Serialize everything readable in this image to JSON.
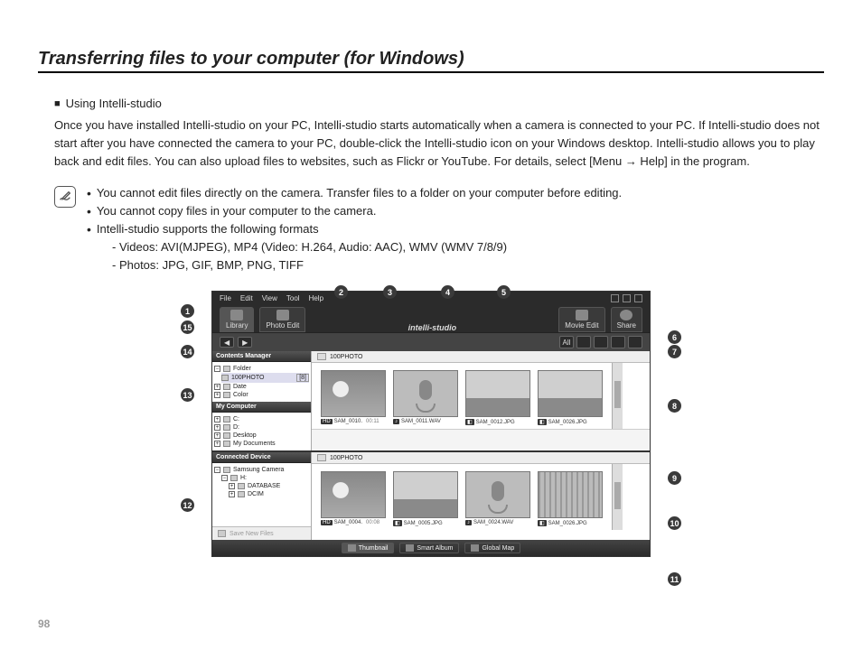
{
  "page": {
    "title": "Transferring files to your computer (for Windows)",
    "number": "98"
  },
  "section": {
    "subhead": "Using Intelli-studio",
    "paragraph": "Once you have installed Intelli-studio on your PC, Intelli-studio starts automatically when a camera is connected to your PC. If Intelli-studio does not start after you have connected the camera to your PC, double-click the Intelli-studio icon on your Windows desktop. Intelli-studio allows you to play back and edit files. You can also upload files to websites, such as Flickr or YouTube. For details, select [Menu → Help] in the program."
  },
  "notes": {
    "items": [
      "You cannot edit files directly on the camera. Transfer files to a folder on your computer before editing.",
      "You cannot copy files in your computer to the camera.",
      "Intelli-studio supports the following formats"
    ],
    "sub": [
      "- Videos: AVI(MJPEG), MP4 (Video: H.264, Audio: AAC), WMV (WMV 7/8/9)",
      "- Photos: JPG, GIF, BMP, PNG, TIFF"
    ]
  },
  "app": {
    "brand": "intelli-studio",
    "menu": [
      "File",
      "Edit",
      "View",
      "Tool",
      "Help"
    ],
    "tabs": {
      "library": "Library",
      "photo": "Photo Edit",
      "movie": "Movie Edit",
      "share": "Share"
    },
    "viewbar": {
      "all": "All"
    },
    "sidebar": {
      "contents_head": "Contents Manager",
      "folder": "Folder",
      "folder_sel": "100PHOTO",
      "folder_count": "[8]",
      "date": "Date",
      "color": "Color",
      "mycomp_head": "My Computer",
      "drives": [
        "C:",
        "D:",
        "Desktop",
        "My Documents"
      ],
      "device_head": "Connected Device",
      "camera": "Samsung Camera",
      "cam_drive": "H:",
      "cam_children": [
        "DATABASE",
        "DCIM"
      ],
      "save": "Save New Files"
    },
    "folders": {
      "upper": "100PHOTO",
      "lower": "100PHOTO"
    },
    "thumbs_upper": [
      {
        "badge": "HD",
        "name": "SAM_0010.",
        "dur": "00:11",
        "kind": "photo2"
      },
      {
        "badge": "♪",
        "name": "SAM_0011.WAV",
        "kind": "mic"
      },
      {
        "badge": "◧",
        "name": "SAM_0012.JPG",
        "kind": "photo"
      },
      {
        "badge": "◧",
        "name": "SAM_0026.JPG",
        "kind": "photo"
      }
    ],
    "thumbs_lower": [
      {
        "badge": "HD",
        "name": "SAM_0004.",
        "dur": "00:08",
        "kind": "photo2"
      },
      {
        "badge": "◧",
        "name": "SAM_0005.JPG",
        "kind": "photo"
      },
      {
        "badge": "♪",
        "name": "SAM_0024.WAV",
        "kind": "mic"
      },
      {
        "badge": "◧",
        "name": "SAM_0026.JPG",
        "kind": "rails"
      }
    ],
    "bottom": {
      "thumb": "Thumbnail",
      "smart": "Smart Album",
      "map": "Global Map"
    }
  },
  "callouts": [
    "1",
    "2",
    "3",
    "4",
    "5",
    "6",
    "7",
    "8",
    "9",
    "10",
    "11",
    "12",
    "13",
    "14",
    "15"
  ]
}
